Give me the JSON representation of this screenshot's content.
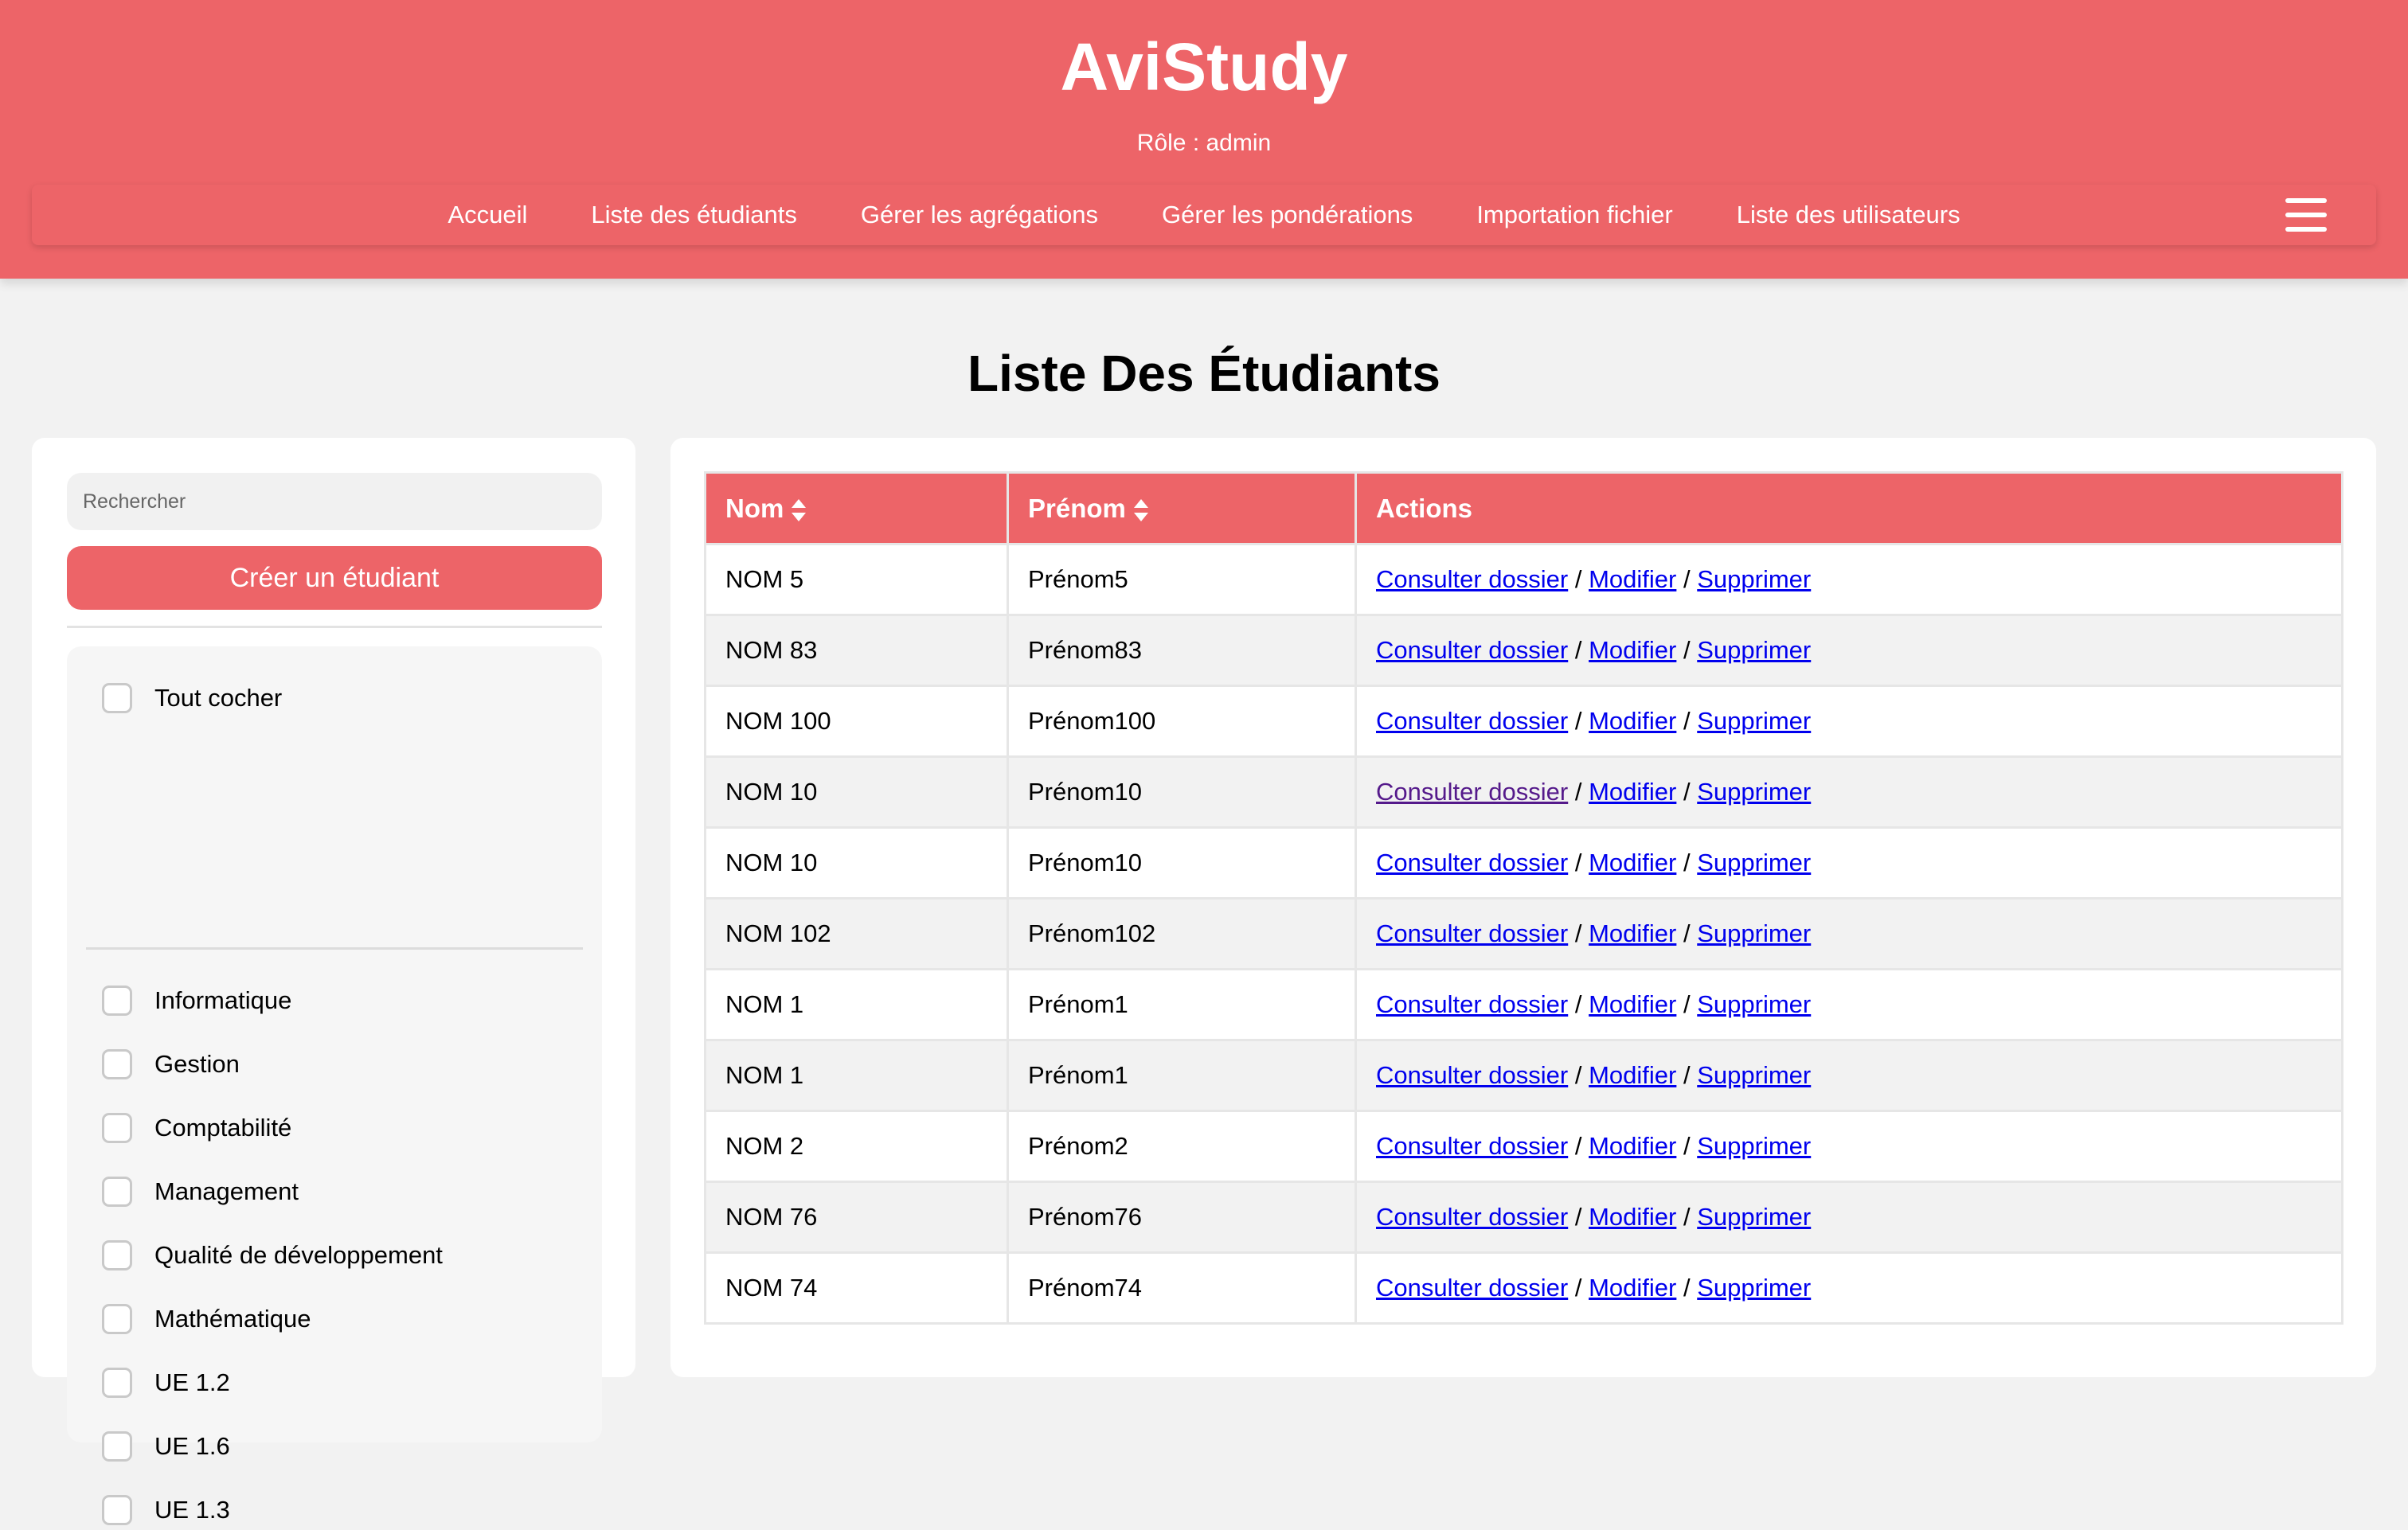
{
  "app": {
    "title": "AviStudy",
    "role": "Rôle : admin"
  },
  "nav": {
    "items": [
      {
        "label": "Accueil"
      },
      {
        "label": "Liste des étudiants"
      },
      {
        "label": "Gérer les agrégations"
      },
      {
        "label": "Gérer les pondérations"
      },
      {
        "label": "Importation fichier"
      },
      {
        "label": "Liste des utilisateurs"
      }
    ],
    "menu_icon": "hamburger-menu-icon"
  },
  "page": {
    "title": "Liste Des Étudiants"
  },
  "sidebar": {
    "search_placeholder": "Rechercher",
    "create_button": "Créer un étudiant",
    "check_all": "Tout cocher",
    "filters": [
      {
        "label": "Informatique"
      },
      {
        "label": "Gestion"
      },
      {
        "label": "Comptabilité"
      },
      {
        "label": "Management"
      },
      {
        "label": "Qualité de développement"
      },
      {
        "label": "Mathématique"
      },
      {
        "label": "UE 1.2"
      },
      {
        "label": "UE 1.6"
      },
      {
        "label": "UE 1.3"
      }
    ]
  },
  "table": {
    "columns": [
      {
        "label": "Nom",
        "sortable": true
      },
      {
        "label": "Prénom",
        "sortable": true
      },
      {
        "label": "Actions",
        "sortable": false
      }
    ],
    "action_labels": {
      "view": "Consulter dossier",
      "edit": "Modifier",
      "delete": "Supprimer",
      "separator": "/"
    },
    "rows": [
      {
        "nom": "NOM 5",
        "prenom": "Prénom5"
      },
      {
        "nom": "NOM 83",
        "prenom": "Prénom83"
      },
      {
        "nom": "NOM 100",
        "prenom": "Prénom100"
      },
      {
        "nom": "NOM 10",
        "prenom": "Prénom10",
        "view_visited": true
      },
      {
        "nom": "NOM 10",
        "prenom": "Prénom10"
      },
      {
        "nom": "NOM 102",
        "prenom": "Prénom102"
      },
      {
        "nom": "NOM 1",
        "prenom": "Prénom1"
      },
      {
        "nom": "NOM 1",
        "prenom": "Prénom1"
      },
      {
        "nom": "NOM 2",
        "prenom": "Prénom2"
      },
      {
        "nom": "NOM 76",
        "prenom": "Prénom76"
      },
      {
        "nom": "NOM 74",
        "prenom": "Prénom74"
      }
    ]
  },
  "colors": {
    "brand": "#ed6468",
    "link": "#0000ee",
    "link_visited": "#551a8b",
    "background": "#f2f2f2"
  }
}
